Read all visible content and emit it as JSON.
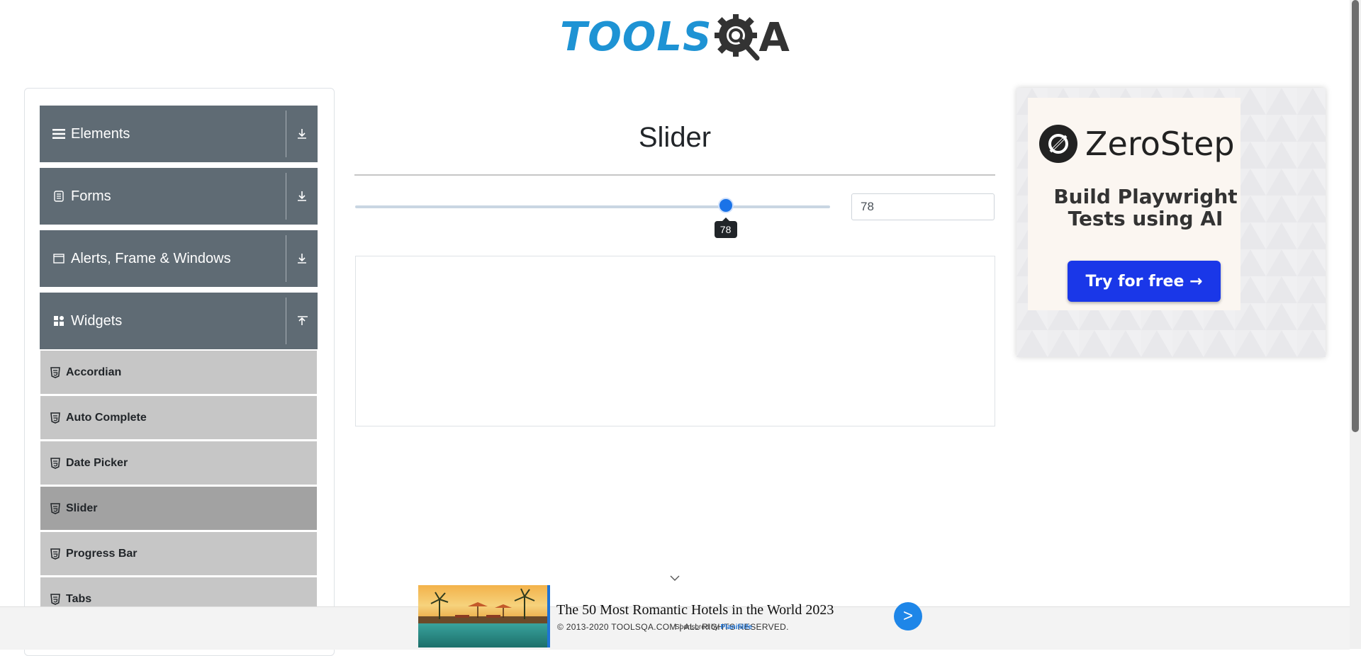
{
  "header": {
    "logo_text": "TOOLS",
    "logo_suffix": "A"
  },
  "sidebar": {
    "groups": [
      {
        "label": "Elements",
        "icon": "hamburger-icon",
        "expanded": false
      },
      {
        "label": "Forms",
        "icon": "form-icon",
        "expanded": false
      },
      {
        "label": "Alerts, Frame & Windows",
        "icon": "window-icon",
        "expanded": false
      },
      {
        "label": "Widgets",
        "icon": "widgets-icon",
        "expanded": true
      }
    ],
    "widget_items": [
      {
        "label": "Accordian",
        "active": false
      },
      {
        "label": "Auto Complete",
        "active": false
      },
      {
        "label": "Date Picker",
        "active": false
      },
      {
        "label": "Slider",
        "active": true
      },
      {
        "label": "Progress Bar",
        "active": false
      },
      {
        "label": "Tabs",
        "active": false
      }
    ]
  },
  "main": {
    "title": "Slider",
    "slider": {
      "value": "78",
      "min": 0,
      "max": 100,
      "tooltip": "78"
    },
    "value_input": "78"
  },
  "right_ad": {
    "brand": "ZeroStep",
    "headline": "Build Playwright Tests using AI",
    "cta": "Try for free →"
  },
  "bottom_ad": {
    "title": "The 50 Most Romantic Hotels in the World 2023",
    "button": ">",
    "sponsored_prefix": "Sponsored by",
    "sponsored_brand": "Planifilife"
  },
  "footer": {
    "copyright": "© 2013-2020 TOOLSQA.COM | ALL RIGHTS RESERVED."
  },
  "colors": {
    "sidebar_header": "#5f6b74",
    "menu_item": "#c6c6c6",
    "menu_active": "#a2a2a2",
    "accent": "#1a73e8",
    "logo_blue": "#1e93d4"
  }
}
